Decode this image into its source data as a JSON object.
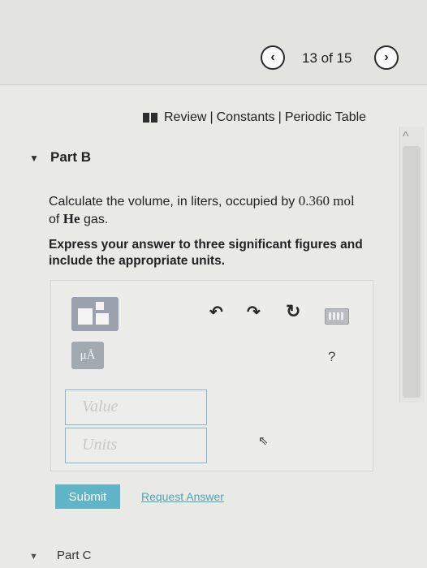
{
  "nav": {
    "prev_icon": "‹",
    "next_icon": "›",
    "page_count": "13 of 15"
  },
  "resources": {
    "review": "Review",
    "constants": "Constants",
    "periodic_table": "Periodic Table",
    "separator": "|"
  },
  "part_b": {
    "toggle_icon": "▼",
    "title": "Part B",
    "question_pre": "Calculate the volume, in liters, occupied by ",
    "amount": "0.360 mol",
    "question_mid": "of ",
    "species": "He",
    "question_post": " gas.",
    "instruction": "Express your answer to three significant figures and include the appropriate units."
  },
  "toolbar": {
    "mu_a_label": "μÅ",
    "undo_icon": "↶",
    "redo_icon": "↷",
    "reset_icon": "↻",
    "help_label": "?"
  },
  "answer": {
    "value_placeholder": "Value",
    "units_placeholder": "Units",
    "value": "",
    "units": ""
  },
  "actions": {
    "submit_label": "Submit",
    "request_answer_label": "Request Answer"
  },
  "part_c": {
    "toggle_icon": "▼",
    "title": "Part C"
  },
  "misc": {
    "scroll_up_icon": "^",
    "cursor_icon": "⇖"
  }
}
